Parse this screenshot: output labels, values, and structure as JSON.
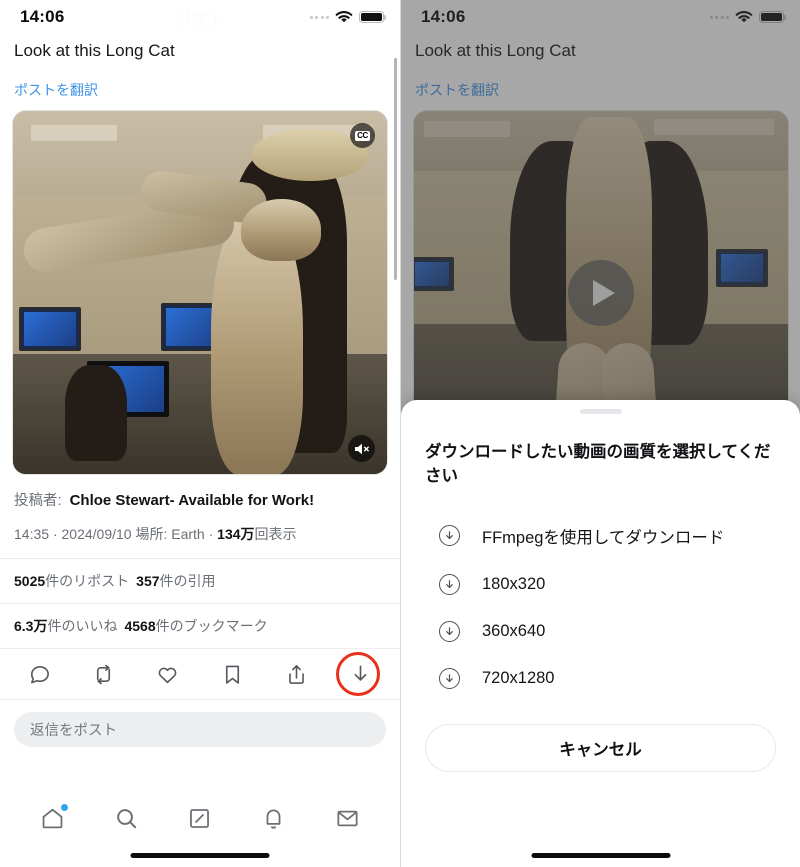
{
  "status_bar": {
    "time": "14:06",
    "signal_icon": "signal-dots-icon",
    "wifi_icon": "wifi-icon",
    "battery_icon": "battery-full-icon"
  },
  "header": {
    "ghost_title": "ポスト"
  },
  "post": {
    "text": "Look at this Long Cat",
    "translate_label": "ポストを翻訳",
    "media": {
      "cc_badge": "CC",
      "mute_icon": "speaker-muted-icon",
      "play_icon": "play-icon"
    },
    "author_prefix": "投稿者:",
    "author_name": "Chloe Stewart- Available for Work!",
    "timestamp_time": "14:35",
    "timestamp_sep1": "·",
    "timestamp_date": "2024/09/10",
    "location_label": "場所: Earth",
    "timestamp_sep2": "·",
    "views_count": "134万",
    "views_suffix": "回表示",
    "stats_line1_a_count": "5025",
    "stats_line1_a_label": "件のリポスト",
    "stats_line1_b_count": "357",
    "stats_line1_b_label": "件の引用",
    "stats_line2_a_count": "6.3万",
    "stats_line2_a_label": "件のいいね",
    "stats_line2_b_count": "4568",
    "stats_line2_b_label": "件のブックマーク"
  },
  "actions": [
    {
      "name": "reply-icon",
      "label": "返信"
    },
    {
      "name": "repost-icon",
      "label": "リポスト"
    },
    {
      "name": "like-icon",
      "label": "いいね"
    },
    {
      "name": "bookmark-icon",
      "label": "ブックマーク"
    },
    {
      "name": "share-icon",
      "label": "共有"
    },
    {
      "name": "download-icon",
      "label": "ダウンロード"
    }
  ],
  "highlight": {
    "target": "download-icon",
    "color": "#e8301a"
  },
  "reply": {
    "placeholder": "返信をポスト"
  },
  "tabbar": [
    {
      "name": "tab-home",
      "icon": "home-icon",
      "badge": true
    },
    {
      "name": "tab-search",
      "icon": "search-icon",
      "badge": false
    },
    {
      "name": "tab-grok",
      "icon": "grok-icon",
      "badge": false
    },
    {
      "name": "tab-notifications",
      "icon": "bell-icon",
      "badge": false
    },
    {
      "name": "tab-messages",
      "icon": "mail-icon",
      "badge": false
    }
  ],
  "sheet": {
    "title": "ダウンロードしたい動画の画質を選択してください",
    "options": [
      {
        "icon": "download-circle-icon",
        "label": "FFmpegを使用してダウンロード"
      },
      {
        "icon": "download-circle-icon",
        "label": "180x320"
      },
      {
        "icon": "download-circle-icon",
        "label": "360x640"
      },
      {
        "icon": "download-circle-icon",
        "label": "720x1280"
      }
    ],
    "cancel_label": "キャンセル"
  }
}
